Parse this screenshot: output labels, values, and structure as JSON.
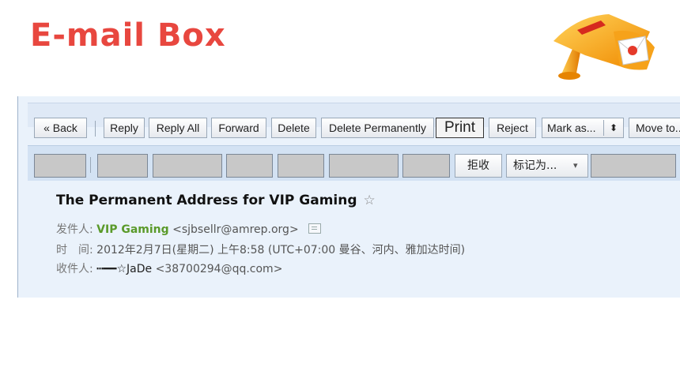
{
  "slide": {
    "title": "E-mail Box"
  },
  "toolbar": {
    "back": "« Back",
    "reply": "Reply",
    "reply_all": "Reply All",
    "forward": "Forward",
    "delete": "Delete",
    "delete_permanently": "Delete Permanently",
    "print": "Print",
    "reject": "Reject",
    "mark_as": "Mark as...",
    "mark_as_arrow": "⬍",
    "move_to": "Move to..."
  },
  "toolbar_cn": {
    "reject": "拒收",
    "mark_as": "标记为...",
    "mark_as_arrow": "▾"
  },
  "message": {
    "subject": "The Permanent Address for VIP Gaming",
    "star": "☆",
    "from_label": "发件人:",
    "from_name": "VIP Gaming",
    "from_email": "<sjbsellr@amrep.org>",
    "time_label": "时　间:",
    "time_value": "2012年2月7日(星期二) 上午8:58 (UTC+07:00 曼谷、河内、雅加达时间)",
    "to_label": "收件人:",
    "to_name": "┅━━☆JaDe",
    "to_email": "<38700294@qq.com>"
  },
  "colors": {
    "title": "#e8473f",
    "sender": "#5a9a2a",
    "panel": "#eaf2fb"
  },
  "icons": {
    "mail": "mailbox-icon",
    "contact": "contact-card-icon"
  }
}
